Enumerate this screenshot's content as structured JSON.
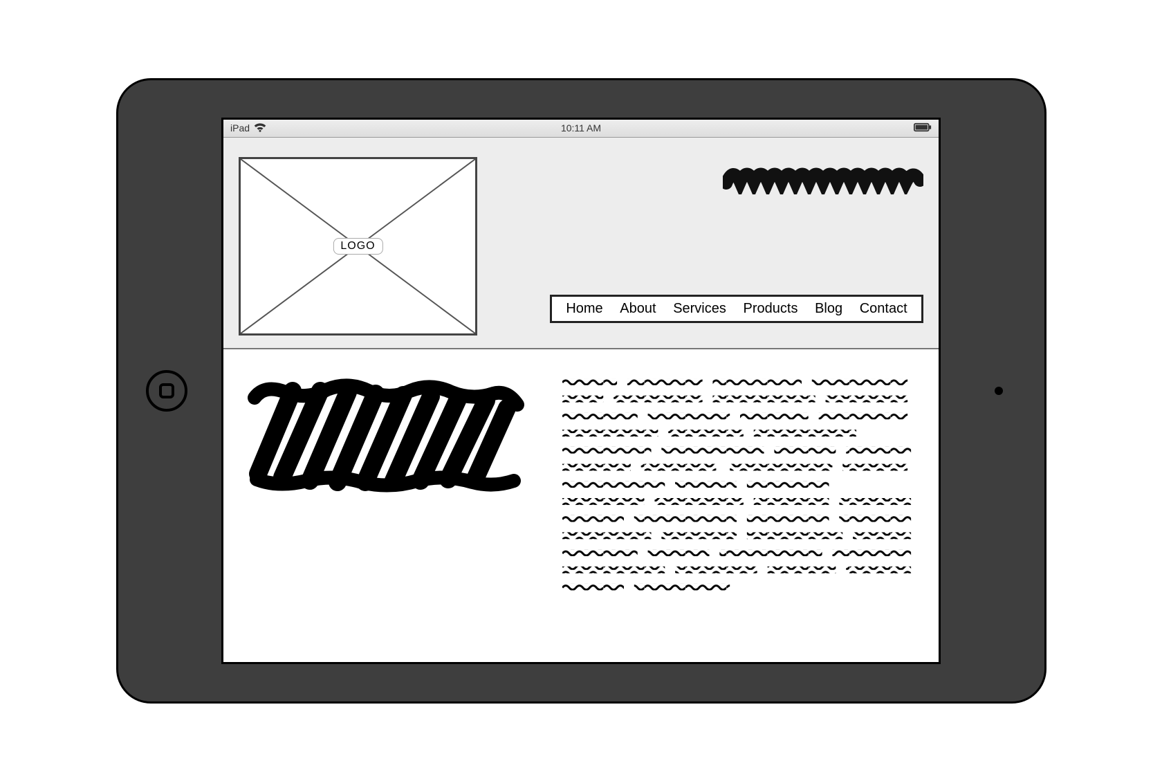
{
  "status_bar": {
    "device_label": "iPad",
    "time": "10:11 AM"
  },
  "header": {
    "logo_label": "LOGO"
  },
  "nav": {
    "items": [
      {
        "label": "Home"
      },
      {
        "label": "About"
      },
      {
        "label": "Services"
      },
      {
        "label": "Products"
      },
      {
        "label": "Blog"
      },
      {
        "label": "Contact"
      }
    ]
  }
}
